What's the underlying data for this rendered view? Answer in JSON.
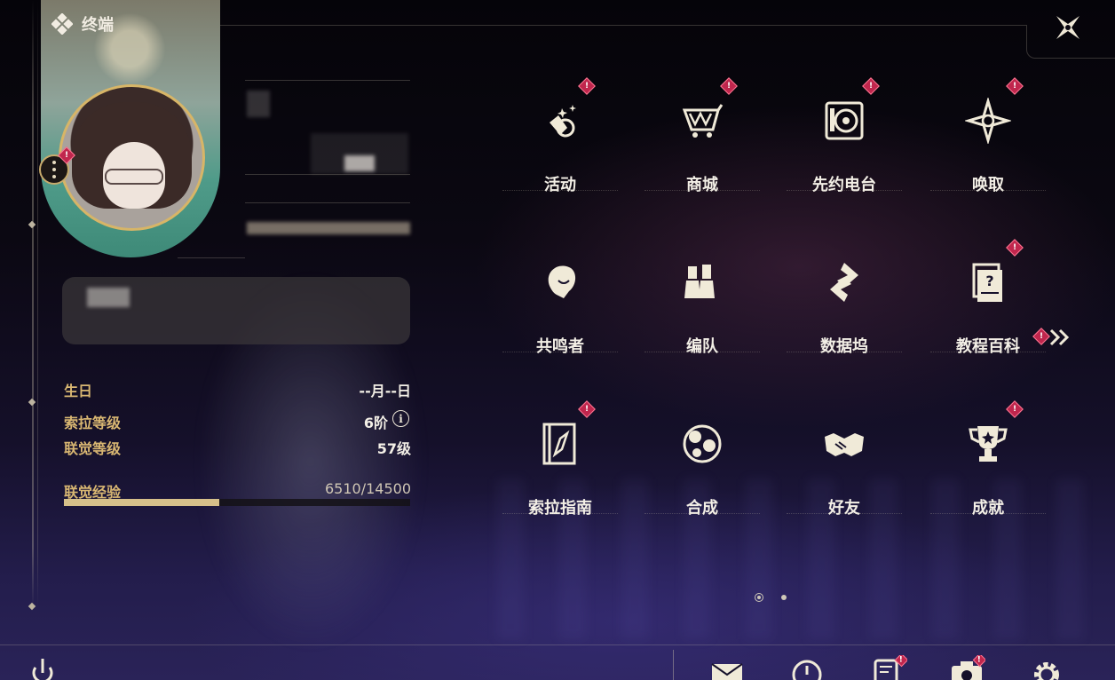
{
  "header": {
    "title": "终端"
  },
  "profile": {
    "stats": [
      {
        "label": "生日",
        "value": "--月--日"
      },
      {
        "label": "索拉等级",
        "value": "6阶"
      },
      {
        "label": "联觉等级",
        "value": "57级"
      },
      {
        "label": "联觉经验",
        "value": "6510/14500"
      }
    ],
    "exp_progress": 0.449
  },
  "menu": {
    "items": [
      {
        "label": "活动",
        "icon": "event-sparkle-icon",
        "badge": "!"
      },
      {
        "label": "商城",
        "icon": "shop-cart-icon",
        "badge": "!"
      },
      {
        "label": "先约电台",
        "icon": "radio-speaker-icon",
        "badge": "!"
      },
      {
        "label": "唤取",
        "icon": "compass-star-icon",
        "badge": "!"
      },
      {
        "label": "共鸣者",
        "icon": "resonator-head-icon",
        "badge": ""
      },
      {
        "label": "编队",
        "icon": "chess-team-icon",
        "badge": ""
      },
      {
        "label": "数据坞",
        "icon": "data-dock-icon",
        "badge": ""
      },
      {
        "label": "教程百科",
        "icon": "tutorial-book-icon",
        "badge": "!"
      },
      {
        "label": "索拉指南",
        "icon": "guide-compass-book-icon",
        "badge": "!"
      },
      {
        "label": "合成",
        "icon": "synthesis-orbs-icon",
        "badge": ""
      },
      {
        "label": "好友",
        "icon": "handshake-icon",
        "badge": ""
      },
      {
        "label": "成就",
        "icon": "trophy-icon",
        "badge": "!"
      }
    ],
    "next_badge": "!",
    "info_icon": "i"
  },
  "bottom": {
    "badges": {
      "notice": "!",
      "camera": "!"
    }
  },
  "colors": {
    "accent_gold": "#d9b772",
    "badge_red": "#c0264d",
    "text": "#f3efe6"
  }
}
